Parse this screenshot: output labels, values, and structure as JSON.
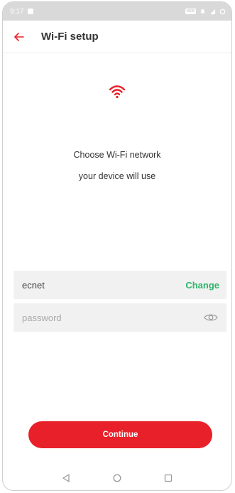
{
  "status_bar": {
    "time": "9:17",
    "badge": "WEB"
  },
  "header": {
    "title": "Wi-Fi setup"
  },
  "message": {
    "line1": "Choose Wi-Fi network",
    "line2": "your device will use"
  },
  "network": {
    "ssid": "ecnet",
    "change_label": "Change"
  },
  "password": {
    "placeholder": "password",
    "value": ""
  },
  "continue_label": "Continue",
  "colors": {
    "accent": "#e8202a",
    "change": "#2fb56a",
    "field_bg": "#f1f1f1",
    "status_bar": "#d9d9d9"
  },
  "icons": {
    "back": "arrow-left-icon",
    "wifi": "wifi-icon",
    "eye": "eye-icon",
    "nav_back": "triangle-back-icon",
    "nav_home": "circle-home-icon",
    "nav_recents": "square-recents-icon"
  }
}
